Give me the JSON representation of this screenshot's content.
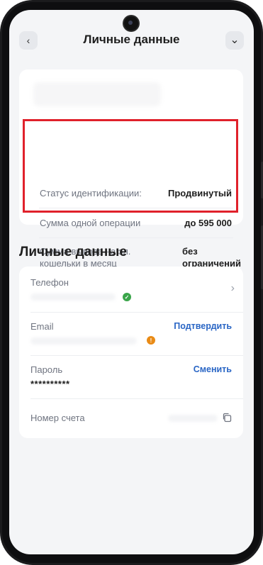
{
  "header": {
    "title": "Личные данные",
    "back_icon": "‹",
    "menu_icon": "⌄"
  },
  "limits": [
    {
      "label": "Статус идентификации:",
      "value": "Продвинутый"
    },
    {
      "label": "Сумма одной операции",
      "value": "до 595 000"
    },
    {
      "label_line1": "Сумма вывода на эл.",
      "label_line2": "кошельки в месяц",
      "value_line1": "без",
      "value_line2": "ограничений"
    }
  ],
  "section": {
    "title": "Личные данные"
  },
  "fields": {
    "phone": {
      "label": "Телефон",
      "status": "verified"
    },
    "email": {
      "label": "Email",
      "action": "Подтвердить",
      "status": "unverified"
    },
    "password": {
      "label": "Пароль",
      "value": "**********",
      "action": "Сменить"
    },
    "account": {
      "label": "Номер счета"
    }
  },
  "colors": {
    "accent_link": "#2a66c5",
    "verified": "#3aa54a",
    "warning": "#e98b16",
    "highlight": "#e0212b"
  }
}
